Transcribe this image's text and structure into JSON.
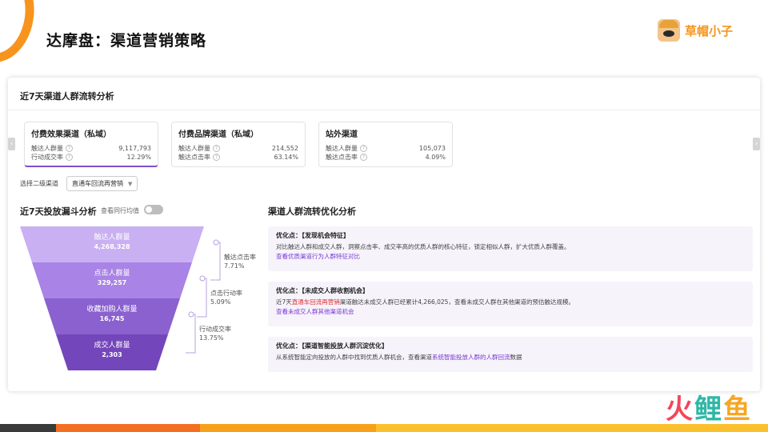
{
  "slide": {
    "title": "达摩盘：渠道营销策略",
    "brand": "草帽小子"
  },
  "panel": {
    "title": "近7天渠道人群流转分析"
  },
  "nav": {
    "prev": "‹",
    "next": "›"
  },
  "channels": [
    {
      "title": "付费效果渠道（私域）",
      "metrics": [
        {
          "label": "触达人群量",
          "value": "9,117,793"
        },
        {
          "label": "行动成交率",
          "value": "12.29%"
        }
      ]
    },
    {
      "title": "付费品牌渠道（私域）",
      "metrics": [
        {
          "label": "触达人群量",
          "value": "214,552"
        },
        {
          "label": "触达点击率",
          "value": "63.14%"
        }
      ]
    },
    {
      "title": "站外渠道",
      "metrics": [
        {
          "label": "触达人群量",
          "value": "105,073"
        },
        {
          "label": "触达点击率",
          "value": "4.09%"
        }
      ]
    }
  ],
  "secondary": {
    "label": "选择二级渠道",
    "selected": "直通车回流再营销"
  },
  "funnel": {
    "title": "近7天投放漏斗分析",
    "toggle_label": "查看同行均值",
    "stages": [
      {
        "label": "触达人群量",
        "value": "4,268,328"
      },
      {
        "label": "点击人群量",
        "value": "329,257"
      },
      {
        "label": "收藏加购人群量",
        "value": "16,745"
      },
      {
        "label": "成交人群量",
        "value": "2,303"
      }
    ],
    "conversions": [
      {
        "label": "触达点击率",
        "value": "7.71%"
      },
      {
        "label": "点击行动率",
        "value": "5.09%"
      },
      {
        "label": "行动成交率",
        "value": "13.75%"
      }
    ],
    "colors": [
      "#c9b0f2",
      "#a983e6",
      "#8a61cf",
      "#7446bb"
    ]
  },
  "optimization": {
    "title": "渠道人群流转优化分析",
    "items": [
      {
        "prefix": "优化点：",
        "head": "【发现机会特征】",
        "text": "对比触达人群和成交人群，洞察点击率、成交率高的优质人群的核心特征，锁定相似人群，扩大优质人群覆盖。",
        "link": "查看优质渠道行为人群特征对比"
      },
      {
        "prefix": "优化点：",
        "head": "【未成交人群收割机会】",
        "text_a": "近7天",
        "text_hl": "直通车回流再营销",
        "text_b": "渠道触达未成交人群已经累计4,266,025，查看未成交人群在其他渠道的预估触达规模。",
        "link": "查看未成交人群其他渠道机会"
      },
      {
        "prefix": "优化点：",
        "head": "【渠道智能投放人群沉淀优化】",
        "text_a": "从系统智能定向投放的人群中找到优质人群机会，查看渠道",
        "text_hl": "系统智能投放人群的人群回流",
        "text_b": "数据"
      }
    ]
  },
  "footer": {
    "colors": [
      "#3a3a3a",
      "#f36f21",
      "#f7a11a",
      "#fbc02d"
    ],
    "logo": [
      "火",
      "鲤",
      "鱼"
    ]
  }
}
